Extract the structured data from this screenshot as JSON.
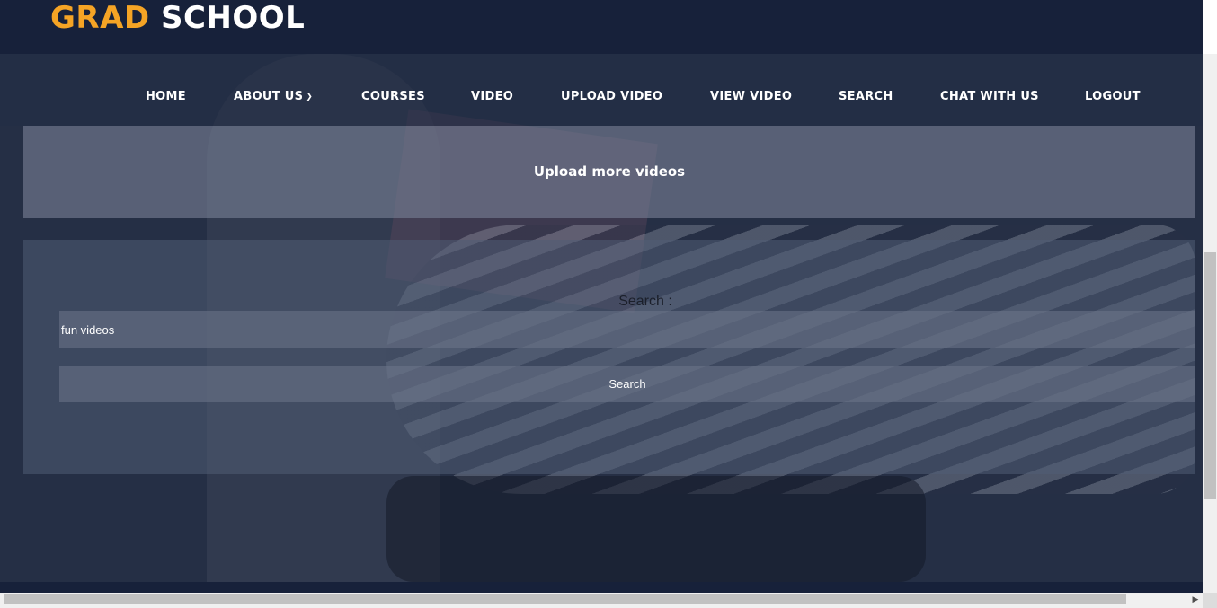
{
  "logo": {
    "part1": "GRAD",
    "part2": "SCHOOL"
  },
  "nav": {
    "items": [
      {
        "label": "HOME"
      },
      {
        "label": "ABOUT US"
      },
      {
        "label": "COURSES"
      },
      {
        "label": "VIDEO"
      },
      {
        "label": "UPLOAD VIDEO"
      },
      {
        "label": "VIEW VIDEO"
      },
      {
        "label": "SEARCH"
      },
      {
        "label": "CHAT WITH US"
      },
      {
        "label": "LOGOUT"
      }
    ],
    "about_chevron_icon": "chevron-down-icon"
  },
  "banner": {
    "text": "Upload more videos"
  },
  "search": {
    "label": "Search :",
    "input_value": "fun videos",
    "button_label": "Search"
  },
  "colors": {
    "accent": "#f5a425",
    "header_bg": "#17213a",
    "overlay": "#252f45"
  }
}
